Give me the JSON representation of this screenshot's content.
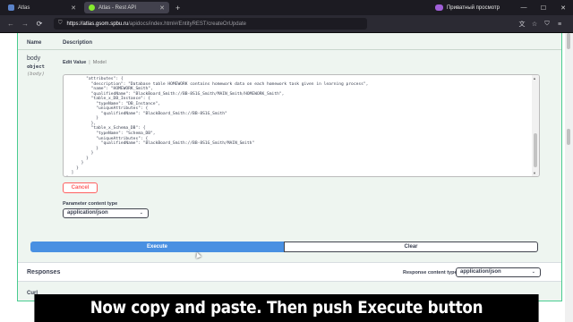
{
  "browser": {
    "tabs": [
      {
        "label": "Atlas",
        "active": false
      },
      {
        "label": "Atlas - Rest API",
        "active": true
      }
    ],
    "new_tab": "+",
    "private_label": "Приватный просмотр",
    "url_host": "https://atlas.gsom.spbu.ru",
    "url_path": "/apidocs/index.html#/EntityREST/createOrUpdate",
    "icons": {
      "back": "←",
      "forward": "→",
      "reload": "⟳",
      "shield": "⛉",
      "translate": "文",
      "star": "☆",
      "shield_right": "⛉",
      "menu": "≡",
      "minimize": "—",
      "maximize": "☐",
      "close": "✕",
      "chevron_down": "⌄"
    }
  },
  "section": {
    "header_name": "Name",
    "header_description": "Description"
  },
  "param": {
    "name": "body",
    "type": "object",
    "location": "(body)",
    "tab_edit": "Edit Value",
    "tab_separator": "|",
    "tab_model": "Model",
    "code_lines": [
      "        \"attributes\": {",
      "          \"description\": \"Database table HOMEWORK contains homework data on each homework task given in learning process\",",
      "          \"name\": \"HOMEWORK_Smith\",",
      "          \"qualifiedName\": \"BlackBoard_Smith://BB-8S1G_Smith/MAIN_Smith/HOMEWORK_Smith\",",
      "          \"table_x_DB_Instance\": {",
      "            \"typeName\": \"DB_Instance\",",
      "            \"uniqueAttributes\": {",
      "              \"qualifiedName\": \"BlackBoard_Smith://BB-8S1G_Smith\"",
      "            }",
      "          },",
      "          \"table_x_Schema_DB\": {",
      "            \"typeName\": \"Schema_DB\",",
      "            \"uniqueAttributes\": {",
      "              \"qualifiedName\": \"BlackBoard_Smith://BB-8S1G_Smith/MAIN_Smith\"",
      "            }",
      "          }",
      "        }",
      "      }",
      "    }",
      "  ]",
      "}"
    ],
    "cancel_label": "Cancel",
    "content_type_label": "Parameter content type",
    "content_type_value": "application/json"
  },
  "actions": {
    "execute_label": "Execute",
    "clear_label": "Clear"
  },
  "responses": {
    "title": "Responses",
    "content_type_label": "Response content type",
    "content_type_value": "application/json",
    "curl_label": "Curl"
  },
  "caption": "Now copy and paste. Then push Execute button"
}
